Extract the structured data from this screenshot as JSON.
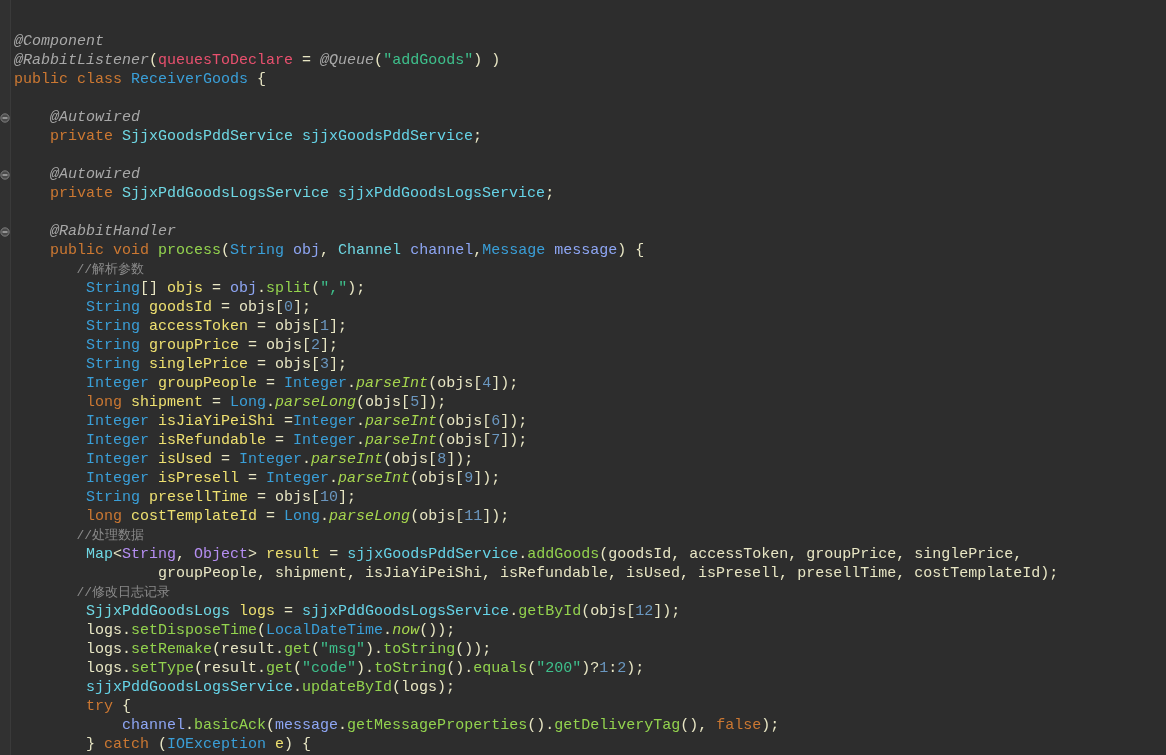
{
  "editor": {
    "lines": [
      {
        "kind": "blank"
      },
      {
        "kind": "blank"
      },
      {
        "kind": "code",
        "tokens": [
          {
            "kind": "ann",
            "text": "@Component"
          }
        ]
      },
      {
        "kind": "code",
        "tokens": [
          {
            "kind": "ann",
            "text": "@RabbitListener"
          },
          {
            "kind": "plain",
            "text": "("
          },
          {
            "kind": "annp",
            "text": "queuesToDeclare"
          },
          {
            "kind": "plain",
            "text": " = "
          },
          {
            "kind": "ann",
            "text": "@Queue"
          },
          {
            "kind": "plain",
            "text": "("
          },
          {
            "kind": "str",
            "text": "\"addGoods\""
          },
          {
            "kind": "plain",
            "text": ") )"
          }
        ]
      },
      {
        "kind": "code",
        "tokens": [
          {
            "kind": "kw",
            "text": "public class "
          },
          {
            "kind": "type",
            "text": "ReceiverGoods"
          },
          {
            "kind": "plain",
            "text": " {"
          }
        ]
      },
      {
        "kind": "blank"
      },
      {
        "kind": "folding",
        "tokens": [
          {
            "kind": "ann",
            "text": "    @Autowired"
          }
        ]
      },
      {
        "kind": "code",
        "tokens": [
          {
            "kind": "kw",
            "text": "    private "
          },
          {
            "kind": "cls",
            "text": "SjjxGoodsPddService "
          },
          {
            "kind": "field",
            "text": "sjjxGoodsPddService"
          },
          {
            "kind": "plain",
            "text": ";"
          }
        ]
      },
      {
        "kind": "blank"
      },
      {
        "kind": "folding",
        "tokens": [
          {
            "kind": "ann",
            "text": "    @Autowired"
          }
        ]
      },
      {
        "kind": "code",
        "tokens": [
          {
            "kind": "kw",
            "text": "    private "
          },
          {
            "kind": "cls",
            "text": "SjjxPddGoodsLogsService "
          },
          {
            "kind": "field",
            "text": "sjjxPddGoodsLogsService"
          },
          {
            "kind": "plain",
            "text": ";"
          }
        ]
      },
      {
        "kind": "blank"
      },
      {
        "kind": "folding",
        "tokens": [
          {
            "kind": "ann",
            "text": "    @RabbitHandler"
          }
        ]
      },
      {
        "kind": "code",
        "tokens": [
          {
            "kind": "kw",
            "text": "    public void "
          },
          {
            "kind": "method",
            "text": "process"
          },
          {
            "kind": "plain",
            "text": "("
          },
          {
            "kind": "type",
            "text": "String "
          },
          {
            "kind": "param",
            "text": "obj"
          },
          {
            "kind": "plain",
            "text": ", "
          },
          {
            "kind": "cls",
            "text": "Channel "
          },
          {
            "kind": "param",
            "text": "channel"
          },
          {
            "kind": "plain",
            "text": ","
          },
          {
            "kind": "type",
            "text": "Message "
          },
          {
            "kind": "param",
            "text": "message"
          },
          {
            "kind": "plain",
            "text": ") {"
          }
        ]
      },
      {
        "kind": "code",
        "tokens": [
          {
            "kind": "comment",
            "text": "        //解析参数"
          }
        ]
      },
      {
        "kind": "code",
        "tokens": [
          {
            "kind": "type",
            "text": "        String"
          },
          {
            "kind": "plain",
            "text": "[] "
          },
          {
            "kind": "local",
            "text": "objs"
          },
          {
            "kind": "plain",
            "text": " = "
          },
          {
            "kind": "param",
            "text": "obj"
          },
          {
            "kind": "plain",
            "text": "."
          },
          {
            "kind": "method",
            "text": "split"
          },
          {
            "kind": "plain",
            "text": "("
          },
          {
            "kind": "str",
            "text": "\",\""
          },
          {
            "kind": "plain",
            "text": ");"
          }
        ]
      },
      {
        "kind": "code",
        "tokens": [
          {
            "kind": "type",
            "text": "        String "
          },
          {
            "kind": "local",
            "text": "goodsId"
          },
          {
            "kind": "plain",
            "text": " = objs["
          },
          {
            "kind": "num",
            "text": "0"
          },
          {
            "kind": "plain",
            "text": "];"
          }
        ]
      },
      {
        "kind": "code",
        "tokens": [
          {
            "kind": "type",
            "text": "        String "
          },
          {
            "kind": "local",
            "text": "accessToken"
          },
          {
            "kind": "plain",
            "text": " = objs["
          },
          {
            "kind": "num",
            "text": "1"
          },
          {
            "kind": "plain",
            "text": "];"
          }
        ]
      },
      {
        "kind": "code",
        "tokens": [
          {
            "kind": "type",
            "text": "        String "
          },
          {
            "kind": "local",
            "text": "groupPrice"
          },
          {
            "kind": "plain",
            "text": " = objs["
          },
          {
            "kind": "num",
            "text": "2"
          },
          {
            "kind": "plain",
            "text": "];"
          }
        ]
      },
      {
        "kind": "code",
        "tokens": [
          {
            "kind": "type",
            "text": "        String "
          },
          {
            "kind": "local",
            "text": "singlePrice"
          },
          {
            "kind": "plain",
            "text": " = objs["
          },
          {
            "kind": "num",
            "text": "3"
          },
          {
            "kind": "plain",
            "text": "];"
          }
        ]
      },
      {
        "kind": "code",
        "tokens": [
          {
            "kind": "type",
            "text": "        Integer "
          },
          {
            "kind": "local",
            "text": "groupPeople"
          },
          {
            "kind": "plain",
            "text": " = "
          },
          {
            "kind": "type",
            "text": "Integer"
          },
          {
            "kind": "plain",
            "text": "."
          },
          {
            "kind": "smethod",
            "text": "parseInt"
          },
          {
            "kind": "plain",
            "text": "(objs["
          },
          {
            "kind": "num",
            "text": "4"
          },
          {
            "kind": "plain",
            "text": "]);"
          }
        ]
      },
      {
        "kind": "code",
        "tokens": [
          {
            "kind": "kw",
            "text": "        long "
          },
          {
            "kind": "local",
            "text": "shipment"
          },
          {
            "kind": "plain",
            "text": " = "
          },
          {
            "kind": "type",
            "text": "Long"
          },
          {
            "kind": "plain",
            "text": "."
          },
          {
            "kind": "smethod",
            "text": "parseLong"
          },
          {
            "kind": "plain",
            "text": "(objs["
          },
          {
            "kind": "num",
            "text": "5"
          },
          {
            "kind": "plain",
            "text": "]);"
          }
        ]
      },
      {
        "kind": "code",
        "tokens": [
          {
            "kind": "type",
            "text": "        Integer "
          },
          {
            "kind": "local",
            "text": "isJiaYiPeiShi"
          },
          {
            "kind": "plain",
            "text": " ="
          },
          {
            "kind": "type",
            "text": "Integer"
          },
          {
            "kind": "plain",
            "text": "."
          },
          {
            "kind": "smethod",
            "text": "parseInt"
          },
          {
            "kind": "plain",
            "text": "(objs["
          },
          {
            "kind": "num",
            "text": "6"
          },
          {
            "kind": "plain",
            "text": "]);"
          }
        ]
      },
      {
        "kind": "code",
        "tokens": [
          {
            "kind": "type",
            "text": "        Integer "
          },
          {
            "kind": "local",
            "text": "isRefundable"
          },
          {
            "kind": "plain",
            "text": " = "
          },
          {
            "kind": "type",
            "text": "Integer"
          },
          {
            "kind": "plain",
            "text": "."
          },
          {
            "kind": "smethod",
            "text": "parseInt"
          },
          {
            "kind": "plain",
            "text": "(objs["
          },
          {
            "kind": "num",
            "text": "7"
          },
          {
            "kind": "plain",
            "text": "]);"
          }
        ]
      },
      {
        "kind": "code",
        "tokens": [
          {
            "kind": "type",
            "text": "        Integer "
          },
          {
            "kind": "local",
            "text": "isUsed"
          },
          {
            "kind": "plain",
            "text": " = "
          },
          {
            "kind": "type",
            "text": "Integer"
          },
          {
            "kind": "plain",
            "text": "."
          },
          {
            "kind": "smethod",
            "text": "parseInt"
          },
          {
            "kind": "plain",
            "text": "(objs["
          },
          {
            "kind": "num",
            "text": "8"
          },
          {
            "kind": "plain",
            "text": "]);"
          }
        ]
      },
      {
        "kind": "code",
        "tokens": [
          {
            "kind": "type",
            "text": "        Integer "
          },
          {
            "kind": "local",
            "text": "isPresell"
          },
          {
            "kind": "plain",
            "text": " = "
          },
          {
            "kind": "type",
            "text": "Integer"
          },
          {
            "kind": "plain",
            "text": "."
          },
          {
            "kind": "smethod",
            "text": "parseInt"
          },
          {
            "kind": "plain",
            "text": "(objs["
          },
          {
            "kind": "num",
            "text": "9"
          },
          {
            "kind": "plain",
            "text": "]);"
          }
        ]
      },
      {
        "kind": "code",
        "tokens": [
          {
            "kind": "type",
            "text": "        String "
          },
          {
            "kind": "local",
            "text": "presellTime"
          },
          {
            "kind": "plain",
            "text": " = objs["
          },
          {
            "kind": "num",
            "text": "10"
          },
          {
            "kind": "plain",
            "text": "];"
          }
        ]
      },
      {
        "kind": "code",
        "tokens": [
          {
            "kind": "kw",
            "text": "        long "
          },
          {
            "kind": "local",
            "text": "costTemplateId"
          },
          {
            "kind": "plain",
            "text": " = "
          },
          {
            "kind": "type",
            "text": "Long"
          },
          {
            "kind": "plain",
            "text": "."
          },
          {
            "kind": "smethod",
            "text": "parseLong"
          },
          {
            "kind": "plain",
            "text": "(objs["
          },
          {
            "kind": "num",
            "text": "11"
          },
          {
            "kind": "plain",
            "text": "]);"
          }
        ]
      },
      {
        "kind": "code",
        "tokens": [
          {
            "kind": "comment",
            "text": "        //处理数据"
          }
        ]
      },
      {
        "kind": "code",
        "tokens": [
          {
            "kind": "cls",
            "text": "        Map"
          },
          {
            "kind": "plain",
            "text": "<"
          },
          {
            "kind": "obj",
            "text": "String"
          },
          {
            "kind": "plain",
            "text": ", "
          },
          {
            "kind": "obj",
            "text": "Object"
          },
          {
            "kind": "plain",
            "text": "> "
          },
          {
            "kind": "local",
            "text": "result"
          },
          {
            "kind": "plain",
            "text": " = "
          },
          {
            "kind": "field",
            "text": "sjjxGoodsPddService"
          },
          {
            "kind": "plain",
            "text": "."
          },
          {
            "kind": "method",
            "text": "addGoods"
          },
          {
            "kind": "plain",
            "text": "(goodsId, accessToken, groupPrice, singlePrice,"
          }
        ]
      },
      {
        "kind": "code",
        "tokens": [
          {
            "kind": "plain",
            "text": "                groupPeople, shipment, isJiaYiPeiShi, isRefundable, isUsed, isPresell, presellTime, costTemplateId);"
          }
        ]
      },
      {
        "kind": "code",
        "tokens": [
          {
            "kind": "comment",
            "text": "        //修改日志记录"
          }
        ]
      },
      {
        "kind": "code",
        "tokens": [
          {
            "kind": "cls",
            "text": "        SjjxPddGoodsLogs "
          },
          {
            "kind": "local",
            "text": "logs"
          },
          {
            "kind": "plain",
            "text": " = "
          },
          {
            "kind": "field",
            "text": "sjjxPddGoodsLogsService"
          },
          {
            "kind": "plain",
            "text": "."
          },
          {
            "kind": "method",
            "text": "getById"
          },
          {
            "kind": "plain",
            "text": "(objs["
          },
          {
            "kind": "num",
            "text": "12"
          },
          {
            "kind": "plain",
            "text": "]);"
          }
        ]
      },
      {
        "kind": "code",
        "tokens": [
          {
            "kind": "plain",
            "text": "        logs."
          },
          {
            "kind": "method",
            "text": "setDisposeTime"
          },
          {
            "kind": "plain",
            "text": "("
          },
          {
            "kind": "type",
            "text": "LocalDateTime"
          },
          {
            "kind": "plain",
            "text": "."
          },
          {
            "kind": "smethod",
            "text": "now"
          },
          {
            "kind": "plain",
            "text": "());"
          }
        ]
      },
      {
        "kind": "code",
        "tokens": [
          {
            "kind": "plain",
            "text": "        logs."
          },
          {
            "kind": "method",
            "text": "setRemake"
          },
          {
            "kind": "plain",
            "text": "(result."
          },
          {
            "kind": "method",
            "text": "get"
          },
          {
            "kind": "plain",
            "text": "("
          },
          {
            "kind": "str",
            "text": "\"msg\""
          },
          {
            "kind": "plain",
            "text": ")."
          },
          {
            "kind": "method",
            "text": "toString"
          },
          {
            "kind": "plain",
            "text": "());"
          }
        ]
      },
      {
        "kind": "code",
        "tokens": [
          {
            "kind": "plain",
            "text": "        logs."
          },
          {
            "kind": "method",
            "text": "setType"
          },
          {
            "kind": "plain",
            "text": "(result."
          },
          {
            "kind": "method",
            "text": "get"
          },
          {
            "kind": "plain",
            "text": "("
          },
          {
            "kind": "str",
            "text": "\"code\""
          },
          {
            "kind": "plain",
            "text": ")."
          },
          {
            "kind": "method",
            "text": "toString"
          },
          {
            "kind": "plain",
            "text": "()."
          },
          {
            "kind": "method",
            "text": "equals"
          },
          {
            "kind": "plain",
            "text": "("
          },
          {
            "kind": "str",
            "text": "\"200\""
          },
          {
            "kind": "plain",
            "text": ")?"
          },
          {
            "kind": "num",
            "text": "1"
          },
          {
            "kind": "plain",
            "text": ":"
          },
          {
            "kind": "num",
            "text": "2"
          },
          {
            "kind": "plain",
            "text": ");"
          }
        ]
      },
      {
        "kind": "code",
        "tokens": [
          {
            "kind": "field",
            "text": "        sjjxPddGoodsLogsService"
          },
          {
            "kind": "plain",
            "text": "."
          },
          {
            "kind": "method",
            "text": "updateById"
          },
          {
            "kind": "plain",
            "text": "(logs);"
          }
        ]
      },
      {
        "kind": "code",
        "tokens": [
          {
            "kind": "kw",
            "text": "        try"
          },
          {
            "kind": "plain",
            "text": " {"
          }
        ]
      },
      {
        "kind": "code",
        "tokens": [
          {
            "kind": "param",
            "text": "            channel"
          },
          {
            "kind": "plain",
            "text": "."
          },
          {
            "kind": "method",
            "text": "basicAck"
          },
          {
            "kind": "plain",
            "text": "("
          },
          {
            "kind": "param",
            "text": "message"
          },
          {
            "kind": "plain",
            "text": "."
          },
          {
            "kind": "method",
            "text": "getMessageProperties"
          },
          {
            "kind": "plain",
            "text": "()."
          },
          {
            "kind": "method",
            "text": "getDeliveryTag"
          },
          {
            "kind": "plain",
            "text": "(), "
          },
          {
            "kind": "kw",
            "text": "false"
          },
          {
            "kind": "plain",
            "text": ");"
          }
        ]
      },
      {
        "kind": "code",
        "tokens": [
          {
            "kind": "plain",
            "text": "        } "
          },
          {
            "kind": "kw",
            "text": "catch"
          },
          {
            "kind": "plain",
            "text": " ("
          },
          {
            "kind": "type",
            "text": "IOException "
          },
          {
            "kind": "local",
            "text": "e"
          },
          {
            "kind": "plain",
            "text": ") {"
          }
        ]
      }
    ]
  }
}
